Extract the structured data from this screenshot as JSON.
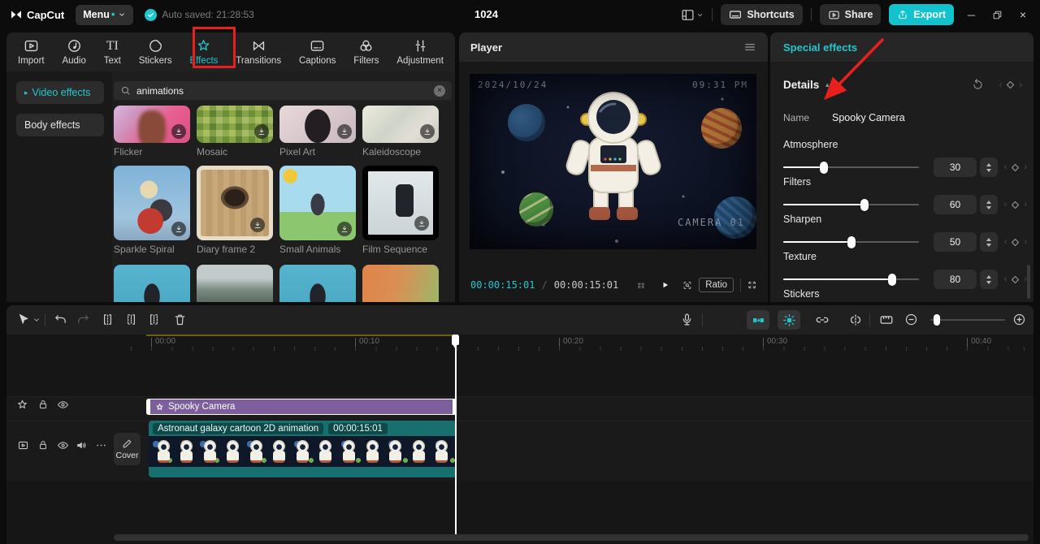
{
  "topbar": {
    "logo_text": "CapCut",
    "menu_label": "Menu",
    "menu_dot": "•",
    "autosave_text": "Auto saved: 21:28:53",
    "project_title": "1024",
    "shortcuts_label": "Shortcuts",
    "share_label": "Share",
    "export_label": "Export",
    "window_close": "×"
  },
  "media_panel": {
    "tabs": [
      {
        "label": "Import"
      },
      {
        "label": "Audio"
      },
      {
        "label": "Text"
      },
      {
        "label": "Stickers"
      },
      {
        "label": "Effects"
      },
      {
        "label": "Transitions"
      },
      {
        "label": "Captions"
      },
      {
        "label": "Filters"
      },
      {
        "label": "Adjustment"
      }
    ],
    "text_tool_glyph": "TI",
    "categories": [
      {
        "label": "Video effects",
        "arrow": "▸"
      },
      {
        "label": "Body effects"
      }
    ],
    "search_value": "animations",
    "clear_glyph": "×",
    "effects": [
      {
        "name": "Flicker"
      },
      {
        "name": "Mosaic"
      },
      {
        "name": "Pixel Art"
      },
      {
        "name": "Kaleidoscope"
      },
      {
        "name": "Sparkle Spiral"
      },
      {
        "name": "Diary frame 2"
      },
      {
        "name": "Small Animals"
      },
      {
        "name": "Film Sequence"
      }
    ]
  },
  "player": {
    "title": "Player",
    "overlay_date": "2024/10/24",
    "overlay_time": "09:31 PM",
    "overlay_camera": "CAMERA 01",
    "current_time": "00:00:15:01",
    "time_separator": "/",
    "total_time": "00:00:15:01",
    "ratio_label": "Ratio"
  },
  "inspector": {
    "header": "Special effects",
    "section_title": "Details",
    "collapse_glyph": "▲",
    "name_label": "Name",
    "name_value": "Spooky Camera",
    "keyframe_left": "‹",
    "keyframe_right": "›",
    "sliders": [
      {
        "label": "Atmosphere",
        "value": 30
      },
      {
        "label": "Filters",
        "value": 60
      },
      {
        "label": "Sharpen",
        "value": 50
      },
      {
        "label": "Texture",
        "value": 80
      }
    ],
    "next_section_label": "Stickers"
  },
  "timeline": {
    "ruler_labels": [
      "00:00",
      "00:10",
      "00:20",
      "00:30",
      "00:40"
    ],
    "effect_clip_label": "Spooky Camera",
    "video_clip_label": "Astronaut galaxy cartoon 2D animation",
    "video_clip_time": "00:00:15:01",
    "cover_label": "Cover"
  },
  "colors": {
    "accent_teal": "#23c6ce",
    "export_teal": "#12c2cc",
    "effect_clip_purple": "#7d5f9e",
    "video_clip_teal": "#17706e",
    "annotation_red": "#e8201d"
  }
}
